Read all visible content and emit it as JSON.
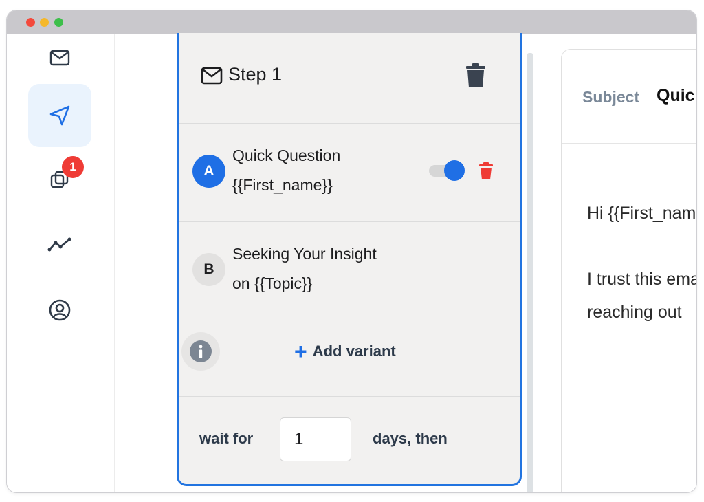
{
  "window": {
    "traffic_lights": [
      "red",
      "yellow",
      "green"
    ]
  },
  "sidebar": {
    "items": [
      {
        "icon": "mail-icon",
        "active": false
      },
      {
        "icon": "send-icon",
        "active": true
      },
      {
        "icon": "copy-icon",
        "active": false,
        "badge": "1"
      },
      {
        "icon": "analytics-icon",
        "active": false
      },
      {
        "icon": "user-icon",
        "active": false
      }
    ]
  },
  "step": {
    "title": "Step 1",
    "variants": [
      {
        "letter": "A",
        "line1": "Quick Question",
        "line2": "{{First_name}}",
        "enabled": true
      },
      {
        "letter": "B",
        "line1": "Seeking Your Insight",
        "line2": "on {{Topic}}"
      }
    ],
    "add_variant_label": "Add variant",
    "wait_label": "wait for",
    "wait_value": "1",
    "days_label": "days, then"
  },
  "email": {
    "subject_label": "Subject",
    "subject_value": "Quick Question {{First_name}}",
    "body_lines": [
      "Hi {{First_name}},",
      "I trust this email finds you well. I'm",
      "reaching out"
    ]
  },
  "colors": {
    "accent": "#1f6fe5",
    "danger": "#ef3b35",
    "card_bg": "#f2f1f0"
  }
}
